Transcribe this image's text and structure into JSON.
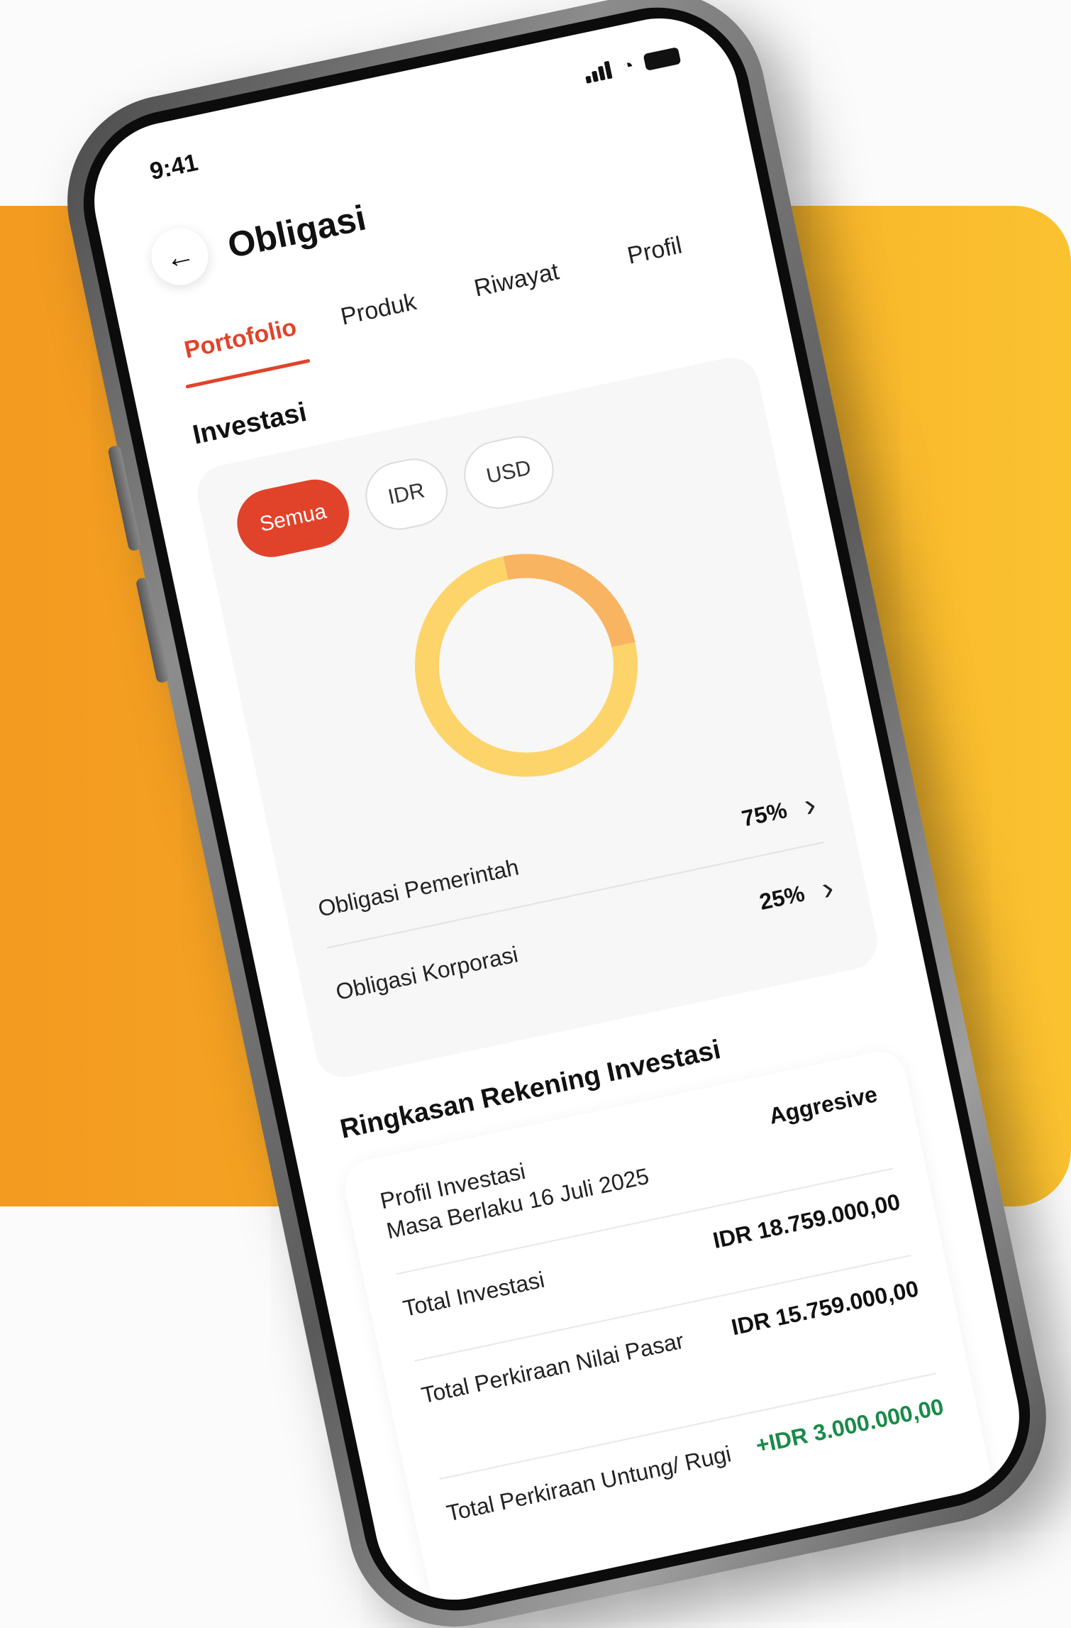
{
  "status": {
    "time": "9:41"
  },
  "header": {
    "title": "Obligasi",
    "back_icon": "arrow-left-icon"
  },
  "tabs": [
    {
      "label": "Portofolio",
      "active": true
    },
    {
      "label": "Produk",
      "active": false
    },
    {
      "label": "Riwayat",
      "active": false
    },
    {
      "label": "Profil",
      "active": false
    }
  ],
  "investasi": {
    "title": "Investasi",
    "filters": [
      {
        "label": "Semua",
        "active": true
      },
      {
        "label": "IDR",
        "active": false
      },
      {
        "label": "USD",
        "active": false
      }
    ],
    "donut": {
      "segments": [
        {
          "label": "Obligasi Pemerintah",
          "value": 75,
          "color": "#fdd46a"
        },
        {
          "label": "Obligasi Korporasi",
          "value": 25,
          "color": "#f8b461"
        }
      ]
    },
    "allocations": [
      {
        "label": "Obligasi Pemerintah",
        "percent": "75%"
      },
      {
        "label": "Obligasi Korporasi",
        "percent": "25%"
      }
    ]
  },
  "ringkasan": {
    "title": "Ringkasan Rekening Investasi",
    "profile_label": "Profil Investasi",
    "profile_validity": "Masa Berlaku 16 Juli 2025",
    "profile_value": "Aggresive",
    "total_investasi_label": "Total Investasi",
    "total_investasi_value": "IDR 18.759.000,00",
    "nilai_pasar_label": "Total Perkiraan Nilai Pasar",
    "nilai_pasar_value": "IDR 15.759.000,00",
    "untung_rugi_label": "Total Perkiraan Untung/ Rugi",
    "untung_rugi_value": "+IDR 3.000.000,00"
  },
  "colors": {
    "accent": "#e1432a",
    "positive": "#1a8a4a",
    "background_band": "#f6ac26"
  }
}
